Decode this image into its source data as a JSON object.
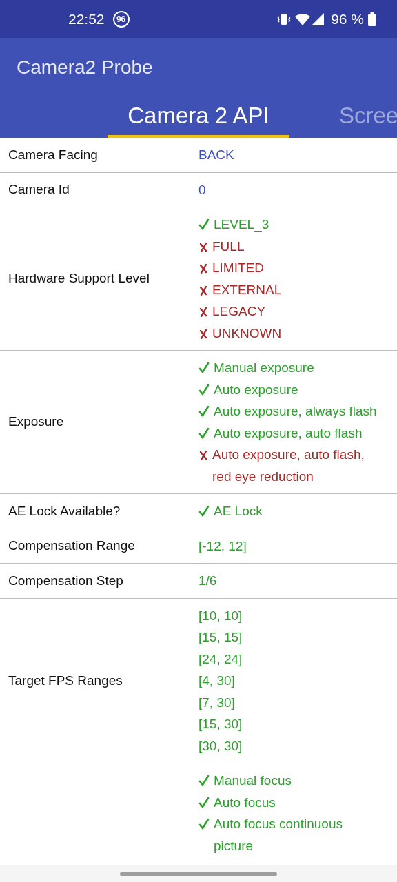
{
  "status_bar": {
    "time": "22:52",
    "badge": "96",
    "battery": "96 %"
  },
  "app_bar": {
    "title": "Camera2 Probe"
  },
  "tabs": [
    {
      "label": "Camera 2 API",
      "selected": true
    },
    {
      "label": "Scree",
      "selected": false
    }
  ],
  "rows": [
    {
      "label": "Camera Facing",
      "values": [
        {
          "kind": "info",
          "text": "BACK"
        }
      ]
    },
    {
      "label": "Camera Id",
      "values": [
        {
          "kind": "info",
          "text": "0"
        }
      ]
    },
    {
      "label": "Hardware Support Level",
      "values": [
        {
          "kind": "supported",
          "text": "LEVEL_3"
        },
        {
          "kind": "unsupported",
          "text": "FULL"
        },
        {
          "kind": "unsupported",
          "text": "LIMITED"
        },
        {
          "kind": "unsupported",
          "text": "EXTERNAL"
        },
        {
          "kind": "unsupported",
          "text": "LEGACY"
        },
        {
          "kind": "unsupported",
          "text": "UNKNOWN"
        }
      ]
    },
    {
      "label": "Exposure",
      "values": [
        {
          "kind": "supported",
          "text": "Manual exposure"
        },
        {
          "kind": "supported",
          "text": "Auto exposure"
        },
        {
          "kind": "supported",
          "text": "Auto exposure, always flash"
        },
        {
          "kind": "supported",
          "text": "Auto exposure, auto flash"
        },
        {
          "kind": "unsupported",
          "text": "Auto exposure, auto flash, red eye reduction"
        }
      ]
    },
    {
      "label": "AE Lock Available?",
      "values": [
        {
          "kind": "supported",
          "text": "AE Lock"
        }
      ]
    },
    {
      "label": "Compensation Range",
      "values": [
        {
          "kind": "value",
          "text": "[-12, 12]"
        }
      ]
    },
    {
      "label": "Compensation Step",
      "values": [
        {
          "kind": "value",
          "text": "1/6"
        }
      ]
    },
    {
      "label": "Target FPS Ranges",
      "values": [
        {
          "kind": "value",
          "text": "[10, 10]"
        },
        {
          "kind": "value",
          "text": "[15, 15]"
        },
        {
          "kind": "value",
          "text": "[24, 24]"
        },
        {
          "kind": "value",
          "text": "[4, 30]"
        },
        {
          "kind": "value",
          "text": "[7, 30]"
        },
        {
          "kind": "value",
          "text": "[15, 30]"
        },
        {
          "kind": "value",
          "text": "[30, 30]"
        }
      ]
    },
    {
      "values": [
        {
          "kind": "supported",
          "text": "Manual focus"
        },
        {
          "kind": "supported",
          "text": "Auto focus"
        },
        {
          "kind": "supported",
          "text": "Auto focus continuous picture"
        }
      ]
    }
  ]
}
